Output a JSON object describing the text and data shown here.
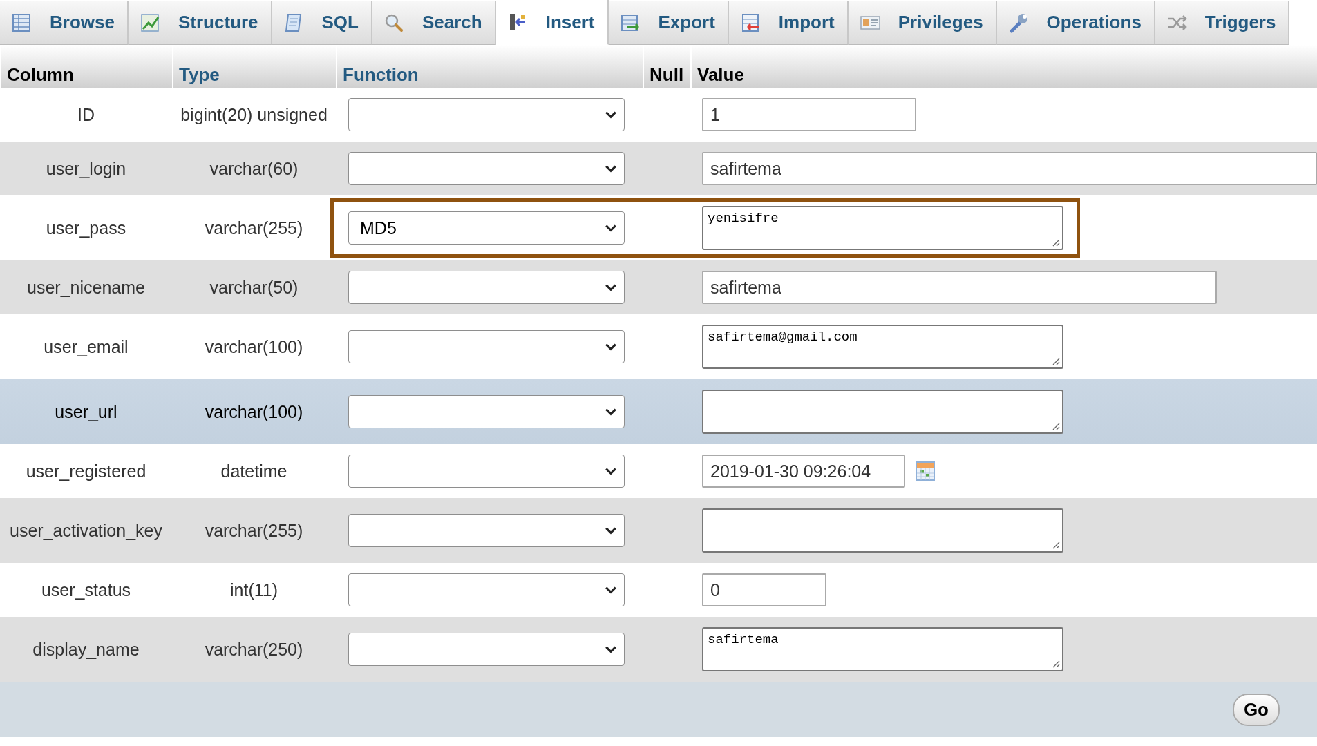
{
  "tabs": [
    {
      "label": "Browse",
      "selected": false
    },
    {
      "label": "Structure",
      "selected": false
    },
    {
      "label": "SQL",
      "selected": false
    },
    {
      "label": "Search",
      "selected": false
    },
    {
      "label": "Insert",
      "selected": true
    },
    {
      "label": "Export",
      "selected": false
    },
    {
      "label": "Import",
      "selected": false
    },
    {
      "label": "Privileges",
      "selected": false
    },
    {
      "label": "Operations",
      "selected": false
    },
    {
      "label": "Triggers",
      "selected": false
    }
  ],
  "table": {
    "columns": [
      {
        "label": "Column",
        "sortable": false
      },
      {
        "label": "Type",
        "sortable": true
      },
      {
        "label": "Function",
        "sortable": true
      },
      {
        "label": "Null",
        "sortable": false
      },
      {
        "label": "Value",
        "sortable": false
      }
    ],
    "rows": [
      {
        "column": "ID",
        "type": "bigint(20) unsigned",
        "function": "",
        "kind": "input",
        "value": "1",
        "highlighted": false,
        "outlined": false
      },
      {
        "column": "user_login",
        "type": "varchar(60)",
        "function": "",
        "kind": "input",
        "value": "safirtema",
        "highlighted": false,
        "outlined": false
      },
      {
        "column": "user_pass",
        "type": "varchar(255)",
        "function": "MD5",
        "kind": "textarea",
        "value": "yenisifre",
        "highlighted": false,
        "outlined": true
      },
      {
        "column": "user_nicename",
        "type": "varchar(50)",
        "function": "",
        "kind": "input",
        "value": "safirtema",
        "highlighted": false,
        "outlined": false
      },
      {
        "column": "user_email",
        "type": "varchar(100)",
        "function": "",
        "kind": "textarea",
        "value": "safirtema@gmail.com",
        "highlighted": false,
        "outlined": false
      },
      {
        "column": "user_url",
        "type": "varchar(100)",
        "function": "",
        "kind": "textarea",
        "value": "",
        "highlighted": true,
        "outlined": false
      },
      {
        "column": "user_registered",
        "type": "datetime",
        "function": "",
        "kind": "date",
        "value": "2019-01-30 09:26:04",
        "highlighted": false,
        "outlined": false
      },
      {
        "column": "user_activation_key",
        "type": "varchar(255)",
        "function": "",
        "kind": "textarea",
        "value": "",
        "highlighted": false,
        "outlined": false
      },
      {
        "column": "user_status",
        "type": "int(11)",
        "function": "",
        "kind": "input",
        "value": "0",
        "highlighted": false,
        "outlined": false
      },
      {
        "column": "display_name",
        "type": "varchar(250)",
        "function": "",
        "kind": "textarea",
        "value": "safirtema",
        "highlighted": false,
        "outlined": false
      }
    ]
  },
  "footer": {
    "button": "Go"
  }
}
